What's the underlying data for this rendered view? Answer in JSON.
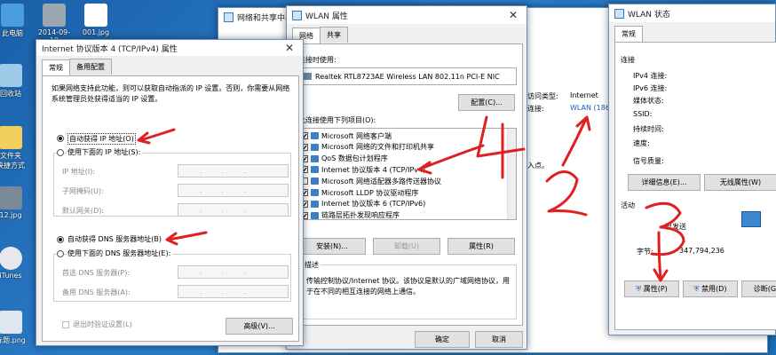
{
  "desktop": {
    "icons": [
      {
        "label": "此电脑"
      },
      {
        "label": "2014-09-19"
      },
      {
        "label": "001.jpg"
      },
      {
        "label": "回收站"
      },
      {
        "label": "文件夹"
      },
      {
        "label": "快捷方式"
      },
      {
        "label": "12.jpg"
      },
      {
        "label": "iTunes"
      },
      {
        "label": "标题.png"
      }
    ],
    "network_window_title": "网络和共享中心",
    "network_window_fragments": {
      "type_label": "访问类型:",
      "type_value": "Internet",
      "conn_label": "连接:",
      "conn_value": "WLAN (1860",
      "hint": "入点。"
    }
  },
  "ipv4_dialog": {
    "title": "Internet 协议版本 4 (TCP/IPv4) 属性",
    "tabs": [
      "常规",
      "备用配置"
    ],
    "description": "如果网络支持此功能，则可以获取自动指派的 IP 设置。否则，你需要从网络系统管理员处获得适当的 IP 设置。",
    "auto_ip": "自动获得 IP 地址(O)",
    "manual_ip": "使用下面的 IP 地址(S):",
    "ip_address": "IP 地址(I):",
    "subnet_mask": "子网掩码(U):",
    "gateway": "默认网关(D):",
    "auto_dns": "自动获得 DNS 服务器地址(B)",
    "manual_dns": "使用下面的 DNS 服务器地址(E):",
    "preferred_dns": "首选 DNS 服务器(P):",
    "alternate_dns": "备用 DNS 服务器(A):",
    "validate_on_exit": "退出时验证设置(L)",
    "advanced_button": "高级(V)..."
  },
  "wlan_properties": {
    "title": "WLAN 属性",
    "tabs": [
      "网络",
      "共享"
    ],
    "connect_using_label": "连接时使用:",
    "adapter": "Realtek RTL8723AE Wireless LAN 802.11n PCI-E NIC",
    "configure_button": "配置(C)...",
    "items_label": "此连接使用下列项目(O):",
    "items": [
      {
        "label": "Microsoft 网络客户端",
        "checked": true
      },
      {
        "label": "Microsoft 网络的文件和打印机共享",
        "checked": true
      },
      {
        "label": "QoS 数据包计划程序",
        "checked": true
      },
      {
        "label": "Internet 协议版本 4 (TCP/IPv4)",
        "checked": true
      },
      {
        "label": "Microsoft 网络适配器多路传送器协议",
        "checked": false
      },
      {
        "label": "Microsoft LLDP 协议驱动程序",
        "checked": true
      },
      {
        "label": "Internet 协议版本 6 (TCP/IPv6)",
        "checked": true
      },
      {
        "label": "链路层拓扑发现响应程序",
        "checked": true
      }
    ],
    "install_button": "安装(N)...",
    "uninstall_button": "卸载(U)",
    "properties_button": "属性(R)",
    "description_label": "描述",
    "description_text": "传输控制协议/Internet 协议。该协议是默认的广域网络协议，用于在不同的相互连接的网络上通信。",
    "ok_button": "确定",
    "cancel_button": "取消"
  },
  "wlan_status": {
    "title": "WLAN 状态",
    "tab": "常规",
    "connection_label": "连接",
    "fields": [
      "IPv4 连接:",
      "IPv6 连接:",
      "媒体状态:",
      "SSID:",
      "持续时间:",
      "速度:"
    ],
    "signal_label": "信号质量:",
    "details_button": "详细信息(E)...",
    "wireless_props_button": "无线属性(W)",
    "activity_label": "活动",
    "sent_label": "已发送",
    "bytes_label": "字节:",
    "bytes_sent": "347,794,236",
    "properties_button": "属性(P)",
    "disable_button": "禁用(D)",
    "diagnose_button": "诊断(G)"
  },
  "annotations": {
    "step2": "2",
    "step3": "3",
    "step4": "4"
  },
  "colors": {
    "annotation_red": "#e02020",
    "desktop_blue": "#1f6fb8"
  }
}
